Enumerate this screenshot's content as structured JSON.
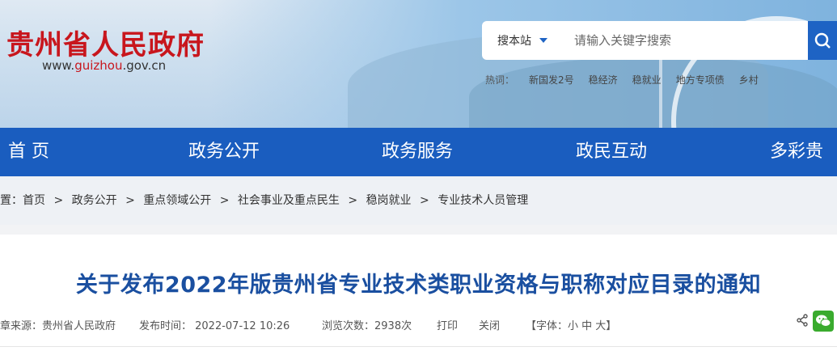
{
  "header": {
    "site_name": "贵州省人民政府",
    "url_prefix": "www.",
    "url_mid": "guizhou",
    "url_suffix": ".gov.cn"
  },
  "search": {
    "scope": "搜本站",
    "placeholder": "请输入关键字搜索",
    "hot_label": "热词：",
    "hot_words": [
      "新国发2号",
      "稳经济",
      "稳就业",
      "地方专项债",
      "乡村"
    ]
  },
  "nav": {
    "items": [
      "首 页",
      "政务公开",
      "政务服务",
      "政民互动",
      "多彩贵州"
    ]
  },
  "breadcrumb": {
    "lead": "置：",
    "items": [
      "首页",
      "政务公开",
      "重点领域公开",
      "社会事业及重点民生",
      "稳岗就业",
      "专业技术人员管理"
    ],
    "separator": ">"
  },
  "article": {
    "title": "关于发布2022年版贵州省专业技术类职业资格与职称对应目录的通知",
    "source": "章来源：贵州省人民政府",
    "publish_time": "发布时间： 2022-07-12 10:26",
    "views": "浏览次数：2938次",
    "print": "打印",
    "close": "关闭",
    "font_size": "【字体：小 中 大】"
  },
  "colors": {
    "brand_red": "#c8161d",
    "nav_blue": "#1a5dbf",
    "title_blue": "#1a4fa0",
    "wechat_green": "#3aab2e"
  }
}
